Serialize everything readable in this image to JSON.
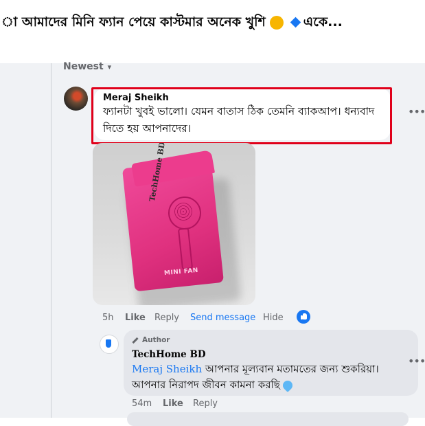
{
  "post": {
    "title_before": "া আমাদের মিনি ফ্যান পেয়ে কাস্টমার অনেক খুশি",
    "title_after": "একে...",
    "emoji_icon": "smiling-face-with-hearts",
    "diamond_icon": "blue-diamond"
  },
  "sort": {
    "label": "Newest"
  },
  "comment": {
    "author": "Meraj Sheikh",
    "text": "ফ্যানটা খুবই ভালো। যেমন বাতাস ঠিক তেমনি ব্যাকআপ। ধন্যবাদ দিতে হয় আপনাদের।",
    "photo_brand": "TechHome BD",
    "photo_label": "MINI FAN",
    "actions": {
      "time": "5h",
      "like": "Like",
      "reply": "Reply",
      "send_message": "Send message",
      "hide": "Hide"
    }
  },
  "reply": {
    "badge": "Author",
    "author": "TechHome BD",
    "mention": "Meraj Sheikh",
    "text": "আপনার মূল্যবান মতামতের জন্য শুকরিয়া। আপনার নিরাপদ জীবন কামনা করছি",
    "actions": {
      "time": "54m",
      "like": "Like",
      "reply": "Reply"
    }
  },
  "colors": {
    "highlight": "#e0001a",
    "link": "#1877f2",
    "bg": "#f0f2f5"
  }
}
